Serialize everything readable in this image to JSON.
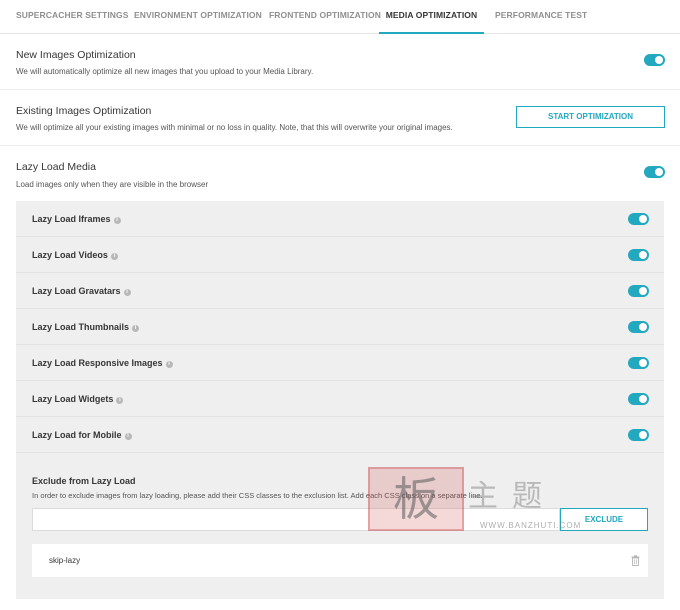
{
  "tabs": [
    {
      "label": "SUPERCACHER SETTINGS"
    },
    {
      "label": "ENVIRONMENT OPTIMIZATION"
    },
    {
      "label": "FRONTEND OPTIMIZATION"
    },
    {
      "label": "MEDIA OPTIMIZATION",
      "active": true
    },
    {
      "label": "PERFORMANCE TEST"
    }
  ],
  "sections": {
    "new_images": {
      "title": "New Images Optimization",
      "description": "We will automatically optimize all new images that you upload to your Media Library.",
      "enabled": true
    },
    "existing_images": {
      "title": "Existing Images Optimization",
      "description": "We will optimize all your existing images with minimal or no loss in quality. Note, that this will overwrite your original images.",
      "button_label": "START OPTIMIZATION"
    },
    "lazy_load": {
      "title": "Lazy Load Media",
      "description": "Load images only when they are visible in the browser",
      "enabled": true
    }
  },
  "lazy_options": [
    {
      "label": "Lazy Load Iframes",
      "enabled": true
    },
    {
      "label": "Lazy Load Videos",
      "enabled": true
    },
    {
      "label": "Lazy Load Gravatars",
      "enabled": true
    },
    {
      "label": "Lazy Load Thumbnails",
      "enabled": true
    },
    {
      "label": "Lazy Load Responsive Images",
      "enabled": true
    },
    {
      "label": "Lazy Load Widgets",
      "enabled": true
    },
    {
      "label": "Lazy Load for Mobile",
      "enabled": true
    }
  ],
  "exclude": {
    "title": "Exclude from Lazy Load",
    "description": "In order to exclude images from lazy loading, please add their CSS classes to the exclusion list. Add each CSS class on a separate line.",
    "input_value": "",
    "button_label": "EXCLUDE",
    "items": [
      "skip-lazy"
    ]
  },
  "watermark": {
    "seal": "板",
    "chars": "主题",
    "url": "WWW.BANZHUTI.COM"
  },
  "colors": {
    "accent": "#22a8bf",
    "panel_bg": "#efefef",
    "text": "#363636"
  },
  "icons": {
    "info": "info-icon",
    "delete": "trash-icon"
  }
}
